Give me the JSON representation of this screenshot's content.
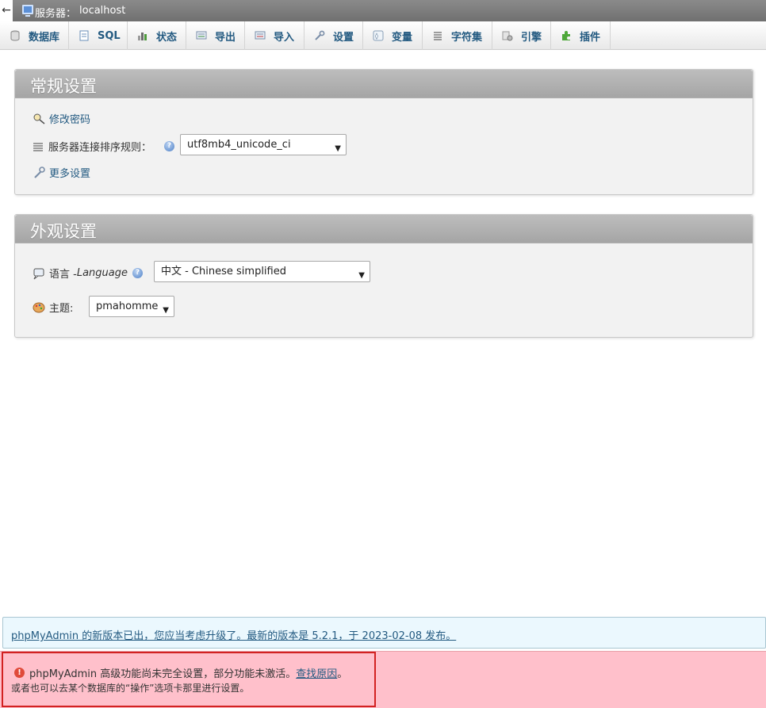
{
  "serverbar": {
    "back_glyph": "←",
    "label": "服务器：",
    "host": "localhost"
  },
  "tabs": [
    {
      "label": "数据库",
      "icon": "database-icon"
    },
    {
      "label": "SQL",
      "icon": "sql-icon"
    },
    {
      "label": "状态",
      "icon": "status-icon"
    },
    {
      "label": "导出",
      "icon": "export-icon"
    },
    {
      "label": "导入",
      "icon": "import-icon"
    },
    {
      "label": "设置",
      "icon": "wrench-icon"
    },
    {
      "label": "变量",
      "icon": "variables-icon"
    },
    {
      "label": "字符集",
      "icon": "charset-icon"
    },
    {
      "label": "引擎",
      "icon": "engine-icon"
    },
    {
      "label": "插件",
      "icon": "plugin-icon"
    }
  ],
  "general": {
    "title": "常规设置",
    "change_password": "修改密码",
    "collation_label": "服务器连接排序规则：",
    "collation_value": "utf8mb4_unicode_ci",
    "more_settings": "更多设置"
  },
  "appearance": {
    "title": "外观设置",
    "language_label": "语言 - ",
    "language_label_en": "Language",
    "language_value": "中文 - Chinese simplified",
    "theme_label": "主题:",
    "theme_value": "pmahomme"
  },
  "notice": {
    "text": "phpMyAdmin 的新版本已出，您应当考虑升级了。最新的版本是 5.2.1，于 2023-02-08 发布。"
  },
  "error": {
    "line1": "phpMyAdmin 高级功能尚未完全设置，部分功能未激活。",
    "link": "查找原因",
    "line1_end": "。",
    "line2": "或者也可以去某个数据库的“操作”选项卡那里进行设置。"
  },
  "colors": {
    "link": "#235a81",
    "error_bg": "#ffc0cb",
    "outline": "#d22222"
  }
}
